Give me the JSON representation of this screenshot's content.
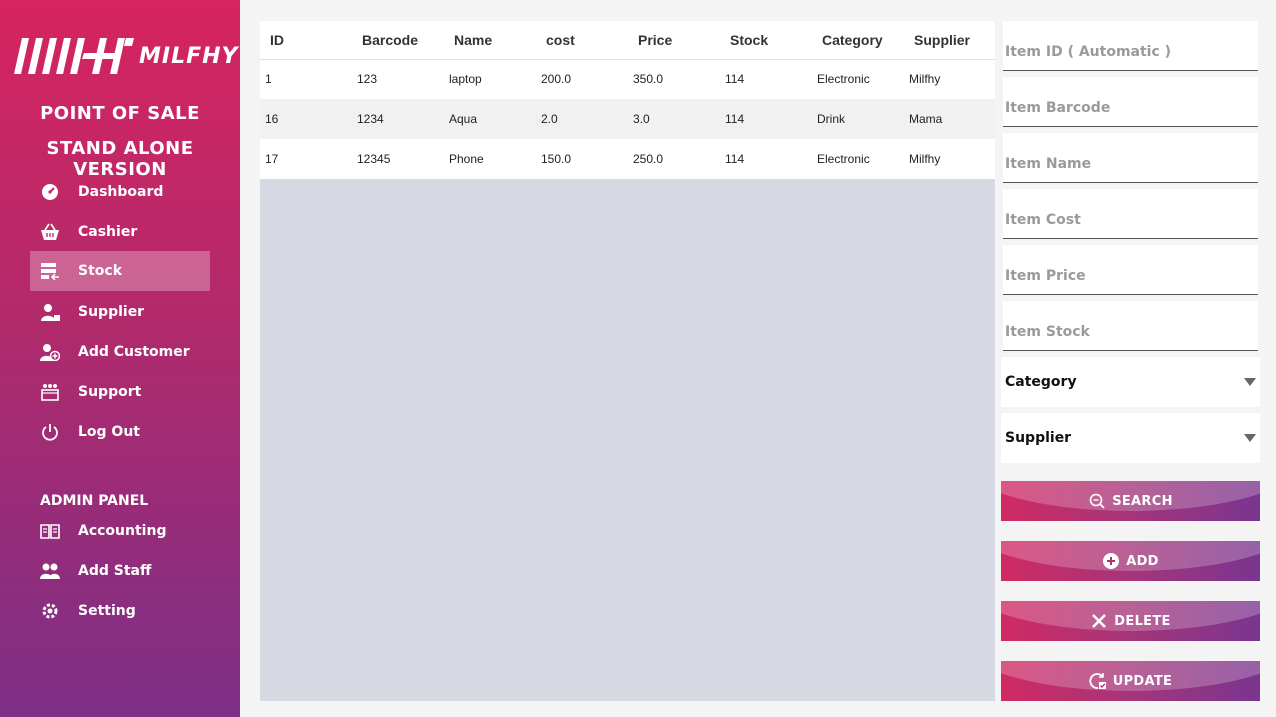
{
  "sidebar": {
    "brand": "MILFHY",
    "title_line1": "POINT OF SALE",
    "title_line2": "STAND ALONE VERSION",
    "items": [
      {
        "label": "Dashboard",
        "icon": "dashboard-icon"
      },
      {
        "label": "Cashier",
        "icon": "basket-icon"
      },
      {
        "label": "Stock",
        "icon": "stock-icon"
      },
      {
        "label": "Supplier",
        "icon": "supplier-icon"
      },
      {
        "label": "Add Customer",
        "icon": "add-customer-icon"
      },
      {
        "label": "Support",
        "icon": "support-icon"
      },
      {
        "label": "Log Out",
        "icon": "power-icon"
      }
    ],
    "admin_label": "ADMIN PANEL",
    "admin_items": [
      {
        "label": "Accounting",
        "icon": "book-icon"
      },
      {
        "label": "Add Staff",
        "icon": "staff-icon"
      },
      {
        "label": "Setting",
        "icon": "gear-icon"
      }
    ],
    "active_item": "Stock",
    "colors": {
      "top": "#d6245f",
      "bottom": "#7c2f86"
    }
  },
  "table": {
    "columns": [
      "ID",
      "Barcode",
      "Name",
      "cost",
      "Price",
      "Stock",
      "Category",
      "Supplier"
    ],
    "rows": [
      [
        "1",
        "123",
        "laptop",
        "200.0",
        "350.0",
        "114",
        "Electronic",
        "Milfhy"
      ],
      [
        "16",
        "1234",
        "Aqua",
        "2.0",
        "3.0",
        "114",
        "Drink",
        "Mama"
      ],
      [
        "17",
        "12345",
        "Phone",
        "150.0",
        "250.0",
        "114",
        "Electronic",
        "Milfhy"
      ]
    ]
  },
  "form": {
    "id_placeholder": "Item ID ( Automatic )",
    "barcode_placeholder": "Item Barcode",
    "name_placeholder": "Item Name",
    "cost_placeholder": "Item Cost",
    "price_placeholder": "Item Price",
    "stock_placeholder": "Item Stock",
    "category_label": "Category",
    "supplier_label": "Supplier"
  },
  "buttons": {
    "search": "SEARCH",
    "add": "ADD",
    "delete": "DELETE",
    "update": "UPDATE"
  }
}
